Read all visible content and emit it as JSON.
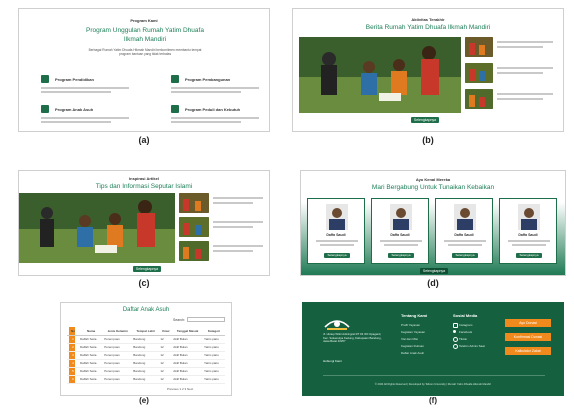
{
  "captions": {
    "a": "(a)",
    "b": "(b)",
    "c": "(c)",
    "d": "(d)",
    "e": "(e)",
    "f": "(f)"
  },
  "panel_a": {
    "eyebrow": "Program Kami",
    "title": "Program Unggulan Rumah Yatim Dhuafa Ilkmah Mandiri",
    "desc": "Berbagai Rumah Yatim Dhuafa Hikmah Mandiri berkomitmen membantu tempat program bantuan yang tidak terbatas",
    "programs": [
      {
        "label": "Program Pendidikan"
      },
      {
        "label": "Program Pembangunan"
      },
      {
        "label": "Program Anak Asuh"
      },
      {
        "label": "Program Peduli dan Kebutuh"
      }
    ]
  },
  "panel_b": {
    "eyebrow": "Aktivitas Terakhir",
    "title": "Berita Rumah Yatim Dhuafa Ilkmah Mandiri",
    "button": "Selengkapnya"
  },
  "panel_c": {
    "eyebrow": "Inspirasi Artikel",
    "title": "Tips dan Informasi Seputar Islami",
    "button": "Selengkapnya"
  },
  "panel_d": {
    "eyebrow": "Ayo Kenal Mereka",
    "title": "Mari Bergabung Untuk Tunaikan Kebaikan",
    "cards": [
      {
        "name": "Daffa Saudi",
        "button": "Selengkapnya"
      },
      {
        "name": "Daffa Saudi",
        "button": "Selengkapnya"
      },
      {
        "name": "Daffa Saudi",
        "button": "Selengkapnya"
      },
      {
        "name": "Daffa Saudi",
        "button": "Selengkapnya"
      }
    ],
    "more_button": "Selengkapnya"
  },
  "panel_e": {
    "title": "Daftar Anak Asuh",
    "search_label": "Search:",
    "columns": [
      "No",
      "Nama",
      "Jenis Kelamin",
      "Tempat Lahir",
      "Umur",
      "Tanggal Masuk",
      "Kategori"
    ],
    "rows": [
      [
        "1",
        "Daffah Setia",
        "Perempuan",
        "Bandung",
        "12",
        "Aktif Bulan",
        "Yatim piatu"
      ],
      [
        "2",
        "Daffah Setia",
        "Perempuan",
        "Bandung",
        "12",
        "Aktif Bulan",
        "Yatim piatu"
      ],
      [
        "3",
        "Daffah Setia",
        "Perempuan",
        "Bandung",
        "12",
        "Aktif Bulan",
        "Yatim piatu"
      ],
      [
        "4",
        "Daffah Setia",
        "Perempuan",
        "Bandung",
        "12",
        "Aktif Bulan",
        "Yatim piatu"
      ],
      [
        "5",
        "Daffah Setia",
        "Perempuan",
        "Bandung",
        "12",
        "Aktif Bulan",
        "Yatim piatu"
      ],
      [
        "6",
        "Daffah Setia",
        "Perempuan",
        "Bandung",
        "12",
        "Aktif Bulan",
        "Yatim piatu"
      ]
    ],
    "pagination": "Previous 1 2 3 Next"
  },
  "panel_f": {
    "address": "Jl. Hintep Wikri Adiningrat RT 03 /03 Cipaganti, Kec. Sukamulya Kedung, Kabupaten Bandung, Jawa Barat 40257",
    "contact": "Hubungi Kami",
    "col1_title": "Tentang Kami",
    "col1_items": [
      "Profil Yayasan",
      "Kegiatan Yayasan",
      "Visi dan Misi",
      "Kegiatan Rutinan",
      "Daftar Anak Asuh"
    ],
    "col2_title": "Sosial Media",
    "col2_items": [
      "Instagram",
      "Facebook",
      "Tiktok",
      "Telefon Admin Saat"
    ],
    "buttons": [
      "Ayo Donasi",
      "Konfirmasi Donasi",
      "Kalkulator Zakat"
    ],
    "copyright": "© 2024 All Rights Reserved | Developed by Telkom University | Rumah Yatim Dhuafa Hikmah Mandiri",
    "accent": "#f08a1c",
    "bg": "#14603f"
  }
}
